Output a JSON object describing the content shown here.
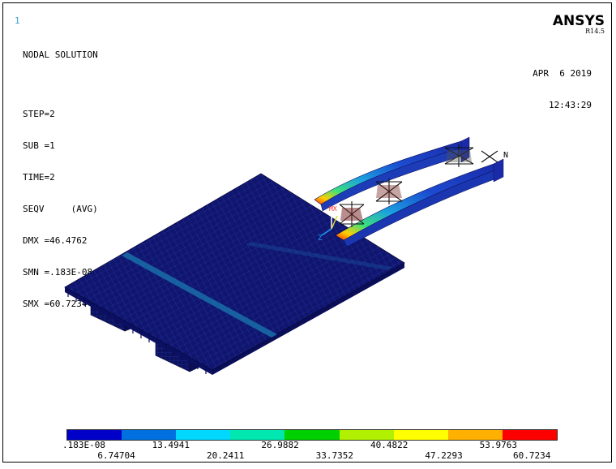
{
  "window_number": "1",
  "info": {
    "title": "NODAL SOLUTION",
    "step": "STEP=2",
    "sub": "SUB =1",
    "time": "TIME=2",
    "seqv": "SEQV     (AVG)",
    "dmx": "DMX =46.4762",
    "smn": "SMN =.183E-08",
    "smx": "SMX =60.7234"
  },
  "brand": {
    "name": "ANSYS",
    "version": "R14.5"
  },
  "datetime": {
    "date": "APR  6 2019",
    "time": "12:43:29"
  },
  "model_labels": {
    "axis_label": "Z",
    "mx_marker": "MX",
    "node_marker": "N"
  },
  "legend": {
    "colors": [
      "#0000c8",
      "#0070e0",
      "#00d8ff",
      "#00e8b0",
      "#00d000",
      "#b0f000",
      "#ffff00",
      "#ffb000",
      "#ff0000"
    ],
    "labels_upper": [
      ".183E-08",
      "13.4941",
      "26.9882",
      "40.4822",
      "53.9763"
    ],
    "labels_lower": [
      "6.74704",
      "20.2411",
      "33.7352",
      "47.2293",
      "60.7234"
    ]
  }
}
